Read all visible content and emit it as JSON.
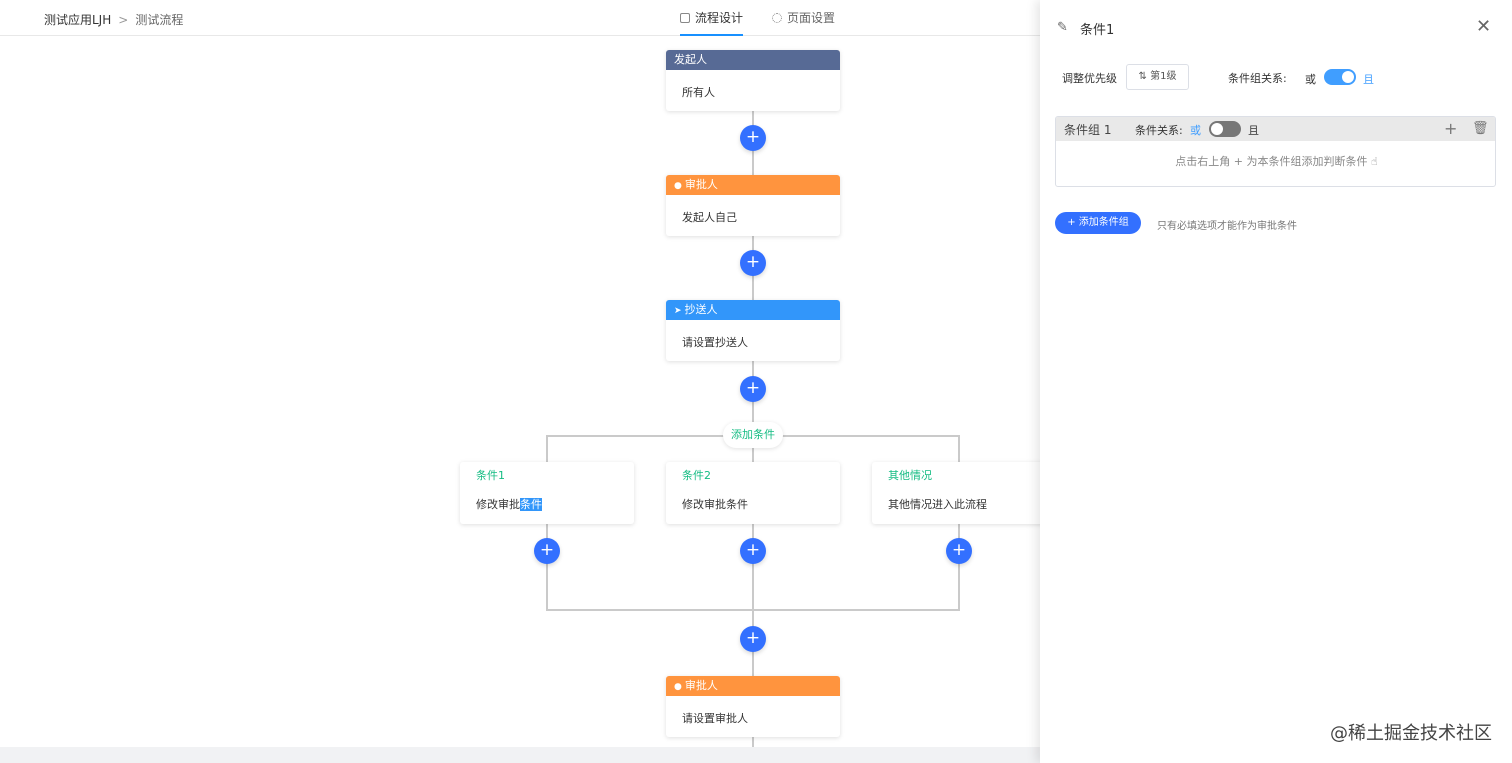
{
  "header": {
    "breadcrumb": [
      "测试应用LJH",
      "测试流程"
    ],
    "breadcrumb_separator": ">",
    "tabs": [
      {
        "label": "流程设计",
        "active": true,
        "icon": "flow-icon"
      },
      {
        "label": "页面设置",
        "active": false,
        "icon": "gear-icon"
      }
    ]
  },
  "flow": {
    "add_symbol": "+",
    "initiator": {
      "title": "发起人",
      "content": "所有人",
      "color": "#576a95"
    },
    "approver1": {
      "title": "审批人",
      "content": "发起人自己",
      "color": "#ff943e",
      "icon": "user-icon"
    },
    "cc": {
      "title": "抄送人",
      "content": "请设置抄送人",
      "color": "#3296fa",
      "icon": "send-icon"
    },
    "add_condition": "添加条件",
    "branches": [
      {
        "title": "条件1",
        "content_prefix": "修改审批",
        "content_selected": "条件"
      },
      {
        "title": "条件2",
        "content": "修改审批条件"
      },
      {
        "title": "其他情况",
        "content": "其他情况进入此流程"
      }
    ],
    "approver2": {
      "title": "审批人",
      "content": "请设置审批人",
      "color": "#ff943e",
      "icon": "user-icon"
    },
    "accent_color": "#3370ff",
    "condition_color": "#15bc83"
  },
  "drawer": {
    "title": "条件1",
    "close_symbol": "✕",
    "priority_label": "调整优先级",
    "priority_value": "第1级",
    "group_relation_label": "条件组关系:",
    "or_label": "或",
    "and_label": "且",
    "group": {
      "title": "条件组 1",
      "relation_label": "条件关系:",
      "or_label": "或",
      "and_label": "且",
      "add_symbol": "+",
      "hint": "点击右上角 + 为本条件组添加判断条件 ☝"
    },
    "add_group_label": "添加条件组",
    "add_group_hint": "只有必填选项才能作为审批条件"
  },
  "watermark": "@稀土掘金技术社区"
}
